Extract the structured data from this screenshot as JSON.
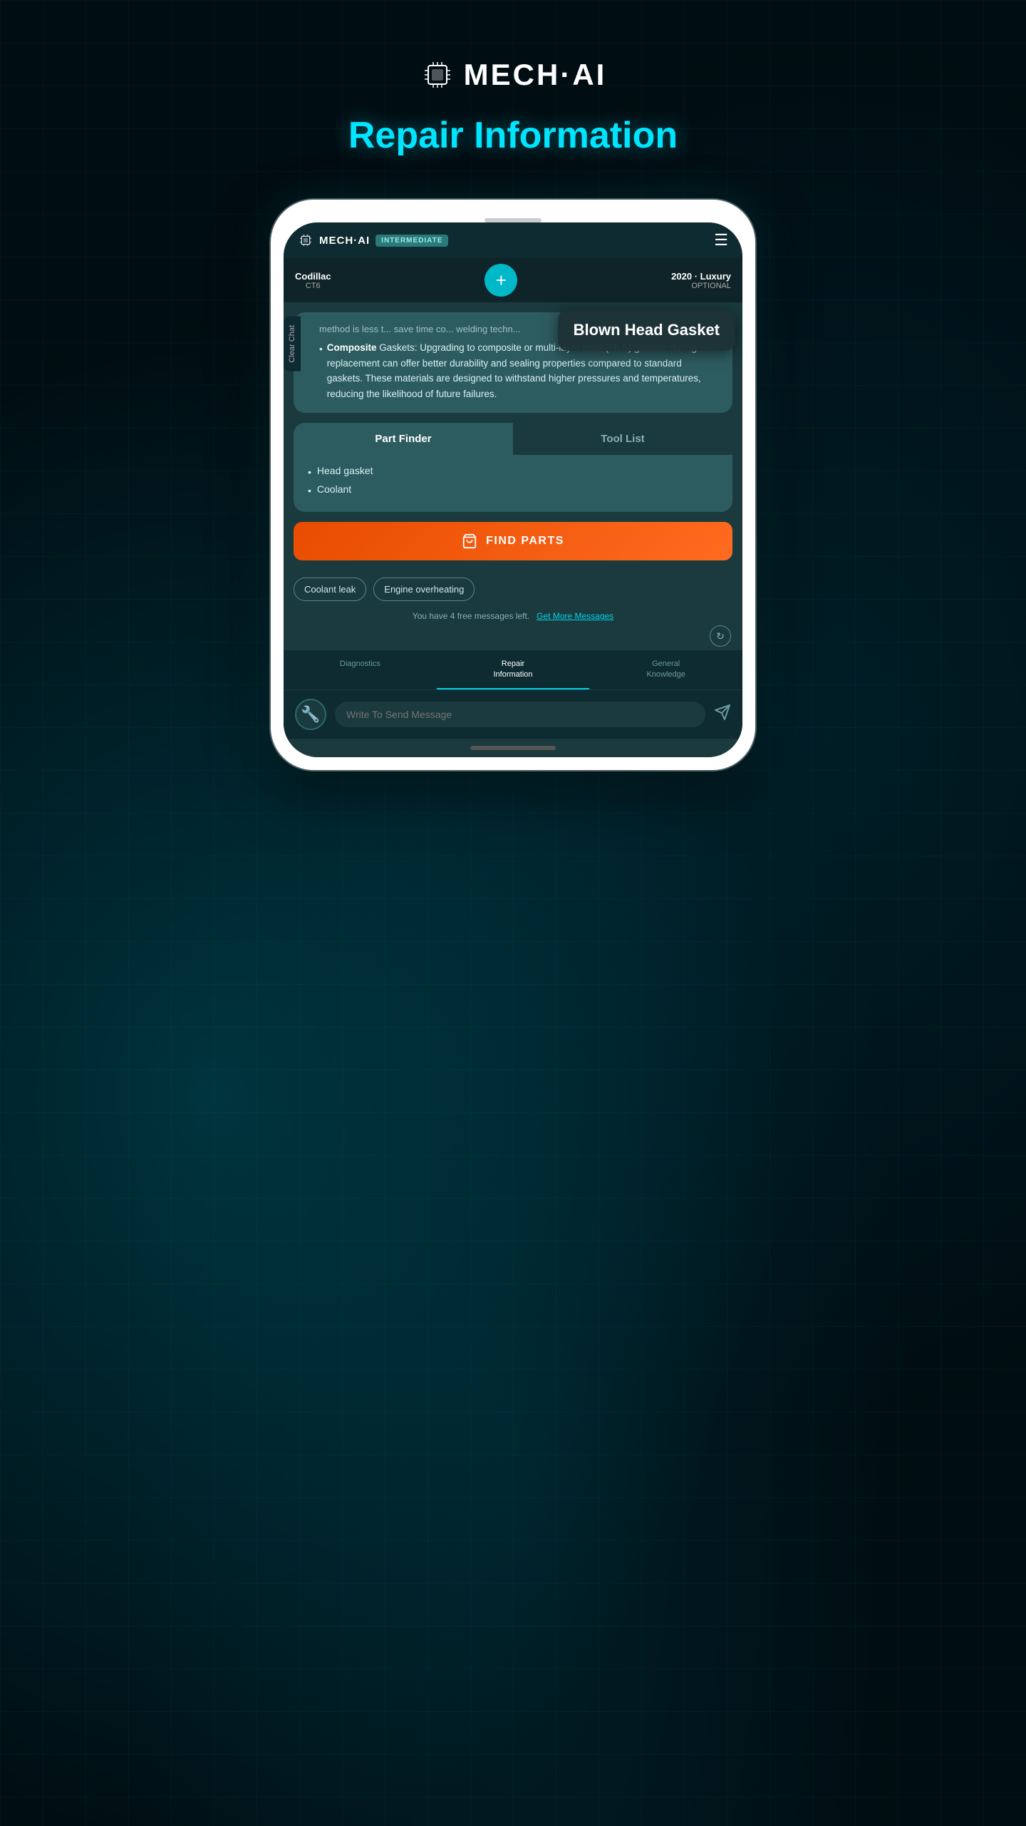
{
  "app": {
    "name": "MECH·AI",
    "page_title": "Repair Information"
  },
  "header": {
    "logo_text": "⊕MECH·AI",
    "badge": "INTERMEDIATE",
    "hamburger": "☰"
  },
  "vehicle": {
    "left_name": "Codillac",
    "left_sub": "CT6",
    "add_icon": "+",
    "right_year": "2020 · Luxury",
    "right_trim": "OPTIONAL"
  },
  "clear_chat": "Clear Chat",
  "tooltip": {
    "text": "Blown Head Gasket"
  },
  "message_truncated": "method is less t... save time co... welding techn...",
  "composite_bullet": {
    "label": "Composite",
    "rest": " Gaskets: Upgrading to composite or multi-layer steel (MLS) gaskets during replacement can offer better durability and sealing properties compared to standard gaskets. These materials are designed to withstand higher pressures and temperatures, reducing the likelihood of future failures."
  },
  "parts_finder": {
    "tab_active": "Part Finder",
    "tab_inactive": "Tool List",
    "items": [
      "Head gasket",
      "Coolant"
    ]
  },
  "find_parts_btn": "FIND PARTS",
  "suggestions": [
    "Coolant leak",
    "Engine overheating"
  ],
  "free_messages": {
    "text": "You have 4 free messages left.",
    "link": "Get More Messages"
  },
  "nav_items": [
    {
      "label": "Diagnostics",
      "active": false
    },
    {
      "label": "Repair\nInformation",
      "active": true
    },
    {
      "label": "General\nKnowledge",
      "active": false
    }
  ],
  "message_input": {
    "placeholder": "Write To Send Message"
  }
}
